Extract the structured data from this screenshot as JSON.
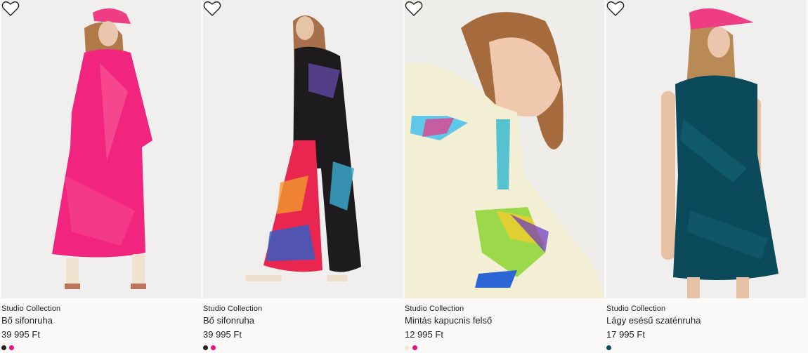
{
  "products": [
    {
      "brand": "Studio Collection",
      "name": "Bő sifonruha",
      "price": "39 995 Ft",
      "swatches": [
        "#222222",
        "#e5127f"
      ]
    },
    {
      "brand": "Studio Collection",
      "name": "Bő sifonruha",
      "price": "39 995 Ft",
      "swatches": [
        "#222222",
        "#e5127f"
      ]
    },
    {
      "brand": "Studio Collection",
      "name": "Mintás kapucnis felső",
      "price": "12 995 Ft",
      "swatches": [
        "#efecd8",
        "#e5127f"
      ]
    },
    {
      "brand": "Studio Collection",
      "name": "Lágy esésű szaténruha",
      "price": "17 995 Ft",
      "swatches": [
        "#0b4a5b"
      ]
    }
  ],
  "icons": {
    "favorite": "heart-outline-icon"
  }
}
